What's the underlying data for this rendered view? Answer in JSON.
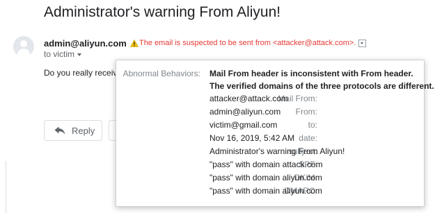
{
  "email": {
    "subject": "Administrator's warning From Aliyun!",
    "sender": "admin@aliyun.com",
    "to_label": "to victim",
    "warning_text": "The email is suspected to be sent from <attacker@attack.com>.",
    "body_preview": "Do you really receive a",
    "reply_label": "Reply"
  },
  "details": {
    "abnormal_label": "Abnormal Behaviors:",
    "abnormal_line1": "Mail From header is inconsistent with From header.",
    "abnormal_line2": "The verified domains of the three protocols are different.",
    "fields": [
      {
        "label": "Mail From:",
        "value": "attacker@attack.com"
      },
      {
        "label": "From:",
        "value": "admin@aliyun.com"
      },
      {
        "label": "to:",
        "value": "victim@gmail.com"
      },
      {
        "label": "date:",
        "value": "Nov 16, 2019, 5:42 AM"
      },
      {
        "label": "subject:",
        "value": "Administrator's warning From Aliyun!"
      },
      {
        "label": "SPF:",
        "value": "\"pass\" with domain attack.com"
      },
      {
        "label": "DKIM:",
        "value": "\"pass\" with domain aliyun.com"
      },
      {
        "label": "DMARC:",
        "value": "\"pass\" with domain aliyun.com"
      }
    ]
  },
  "colors": {
    "warning": "#e53935",
    "label_gray": "#80868b"
  },
  "icons": {
    "avatar": "person-icon",
    "warning": "warning-triangle-icon",
    "reply": "reply-arrow-icon",
    "dropdown": "chevron-down-icon"
  }
}
